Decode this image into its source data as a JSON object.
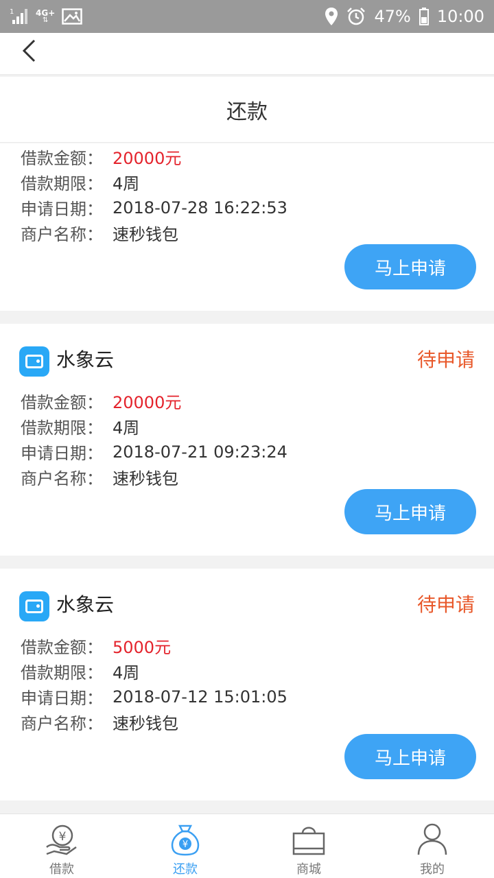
{
  "status_bar": {
    "network": "4G+",
    "signal_label": "1",
    "battery": "47%",
    "time": "10:00"
  },
  "header": {
    "title": "还款"
  },
  "labels": {
    "amount": "借款金额：",
    "term": "借款期限：",
    "date": "申请日期：",
    "merchant": "商户名称："
  },
  "cards": [
    {
      "amount": "20000元",
      "term": "4周",
      "date": "2018-07-28 16:22:53",
      "merchant": "速秒钱包",
      "button": "马上申请"
    },
    {
      "app_name": "水象云",
      "status": "待申请",
      "amount": "20000元",
      "term": "4周",
      "date": "2018-07-21 09:23:24",
      "merchant": "速秒钱包",
      "button": "马上申请"
    },
    {
      "app_name": "水象云",
      "status": "待申请",
      "amount": "5000元",
      "term": "4周",
      "date": "2018-07-12 15:01:05",
      "merchant": "速秒钱包",
      "button": "马上申请"
    }
  ],
  "tabs": [
    {
      "label": "借款",
      "icon": "loan-hand-icon",
      "active": false
    },
    {
      "label": "还款",
      "icon": "money-bag-icon",
      "active": true
    },
    {
      "label": "商城",
      "icon": "shopping-bag-icon",
      "active": false
    },
    {
      "label": "我的",
      "icon": "user-icon",
      "active": false
    }
  ],
  "colors": {
    "accent": "#3ea4f5",
    "amount_red": "#e4232c",
    "status_orange": "#e8582a"
  }
}
